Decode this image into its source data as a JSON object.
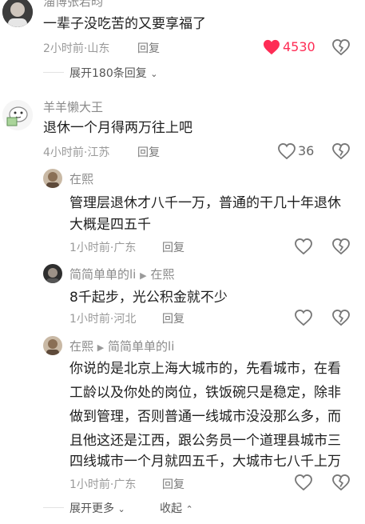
{
  "comments": [
    {
      "username": "淄博张若昀",
      "text": "一辈子没吃苦的又要享福了",
      "time": "2小时前",
      "location": "山东",
      "reply": "回复",
      "likes": "4530",
      "liked": true
    },
    {
      "username": "羊羊懒大王",
      "text": "退休一个月得两万往上吧",
      "time": "4小时前",
      "location": "江苏",
      "reply": "回复",
      "likes": "36",
      "liked": false
    }
  ],
  "expand_first": "展开180条回复",
  "replies": [
    {
      "username": "在熙",
      "lines": [
        "管理层退休才八千一万，普通的干几十年退休",
        "大概是四五千"
      ],
      "time": "1小时前",
      "location": "广东",
      "reply": "回复"
    },
    {
      "username": "简简单单的li",
      "reply_to": "在熙",
      "lines": [
        "8千起步，光公积金就不少"
      ],
      "time": "1小时前",
      "location": "河北",
      "reply": "回复"
    },
    {
      "username": "在熙",
      "reply_to": "简简单单的li",
      "lines": [
        "你说的是北京上海大城市的，先看城市，在看",
        "工龄以及你处的岗位，铁饭碗只是稳定，除非",
        "做到管理，否则普通一线城市没没那么多，而",
        "且他这还是江西，跟公务员一个道理县城市三",
        "四线城市一个月就四五千，大城市七八千上万"
      ],
      "time": "1小时前",
      "location": "广东",
      "reply": "回复"
    }
  ],
  "expand_more": "展开更多",
  "collapse": "收起",
  "colors": {
    "like_red": "#fe2c55",
    "text": "#1e1e1e",
    "meta": "#9a9a9a"
  }
}
